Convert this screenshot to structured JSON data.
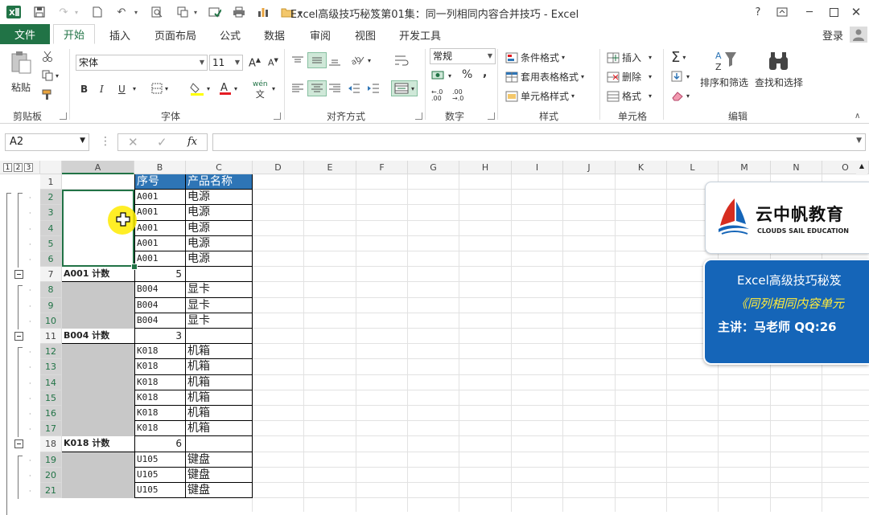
{
  "window": {
    "title": "Excel高级技巧秘笈第01集：同一列相同内容合并技巧 - Excel",
    "help": "?",
    "login": "登录"
  },
  "tabs": {
    "file": "文件",
    "home": "开始",
    "insert": "插入",
    "layout": "页面布局",
    "formula": "公式",
    "data": "数据",
    "review": "审阅",
    "view": "视图",
    "developer": "开发工具"
  },
  "ribbon": {
    "clipboard": {
      "paste": "粘贴",
      "label": "剪贴板"
    },
    "font": {
      "name": "宋体",
      "size": "11",
      "bold": "B",
      "italic": "I",
      "underline": "U",
      "label": "字体",
      "wen": "wén"
    },
    "alignment": {
      "label": "对齐方式"
    },
    "number": {
      "format": "常规",
      "label": "数字"
    },
    "styles": {
      "conditional": "条件格式",
      "table": "套用表格格式",
      "cell": "单元格样式",
      "label": "样式"
    },
    "cells": {
      "insert": "插入",
      "delete": "删除",
      "format": "格式",
      "label": "单元格"
    },
    "editing": {
      "sort": "排序和筛选",
      "find": "查找和选择",
      "label": "编辑"
    }
  },
  "formula_bar": {
    "name_box": "A2",
    "fx": "fx",
    "value": ""
  },
  "sheet": {
    "outline_levels": [
      "1",
      "2",
      "3"
    ],
    "columns": [
      "A",
      "B",
      "C",
      "D",
      "E",
      "F",
      "G",
      "H",
      "I",
      "J",
      "K",
      "L",
      "M",
      "N",
      "O"
    ],
    "rows": [
      {
        "num": "1",
        "a": "",
        "b": "序号",
        "c": "产品名称",
        "kind": "header"
      },
      {
        "num": "2",
        "a": "",
        "b": "A001",
        "c": "电源",
        "kind": "data"
      },
      {
        "num": "3",
        "a": "",
        "b": "A001",
        "c": "电源",
        "kind": "data"
      },
      {
        "num": "4",
        "a": "",
        "b": "A001",
        "c": "电源",
        "kind": "data"
      },
      {
        "num": "5",
        "a": "",
        "b": "A001",
        "c": "电源",
        "kind": "data"
      },
      {
        "num": "6",
        "a": "",
        "b": "A001",
        "c": "电源",
        "kind": "data"
      },
      {
        "num": "7",
        "a": "A001 计数",
        "b": "5",
        "c": "",
        "kind": "sub"
      },
      {
        "num": "8",
        "a": "",
        "b": "B004",
        "c": "显卡",
        "kind": "data"
      },
      {
        "num": "9",
        "a": "",
        "b": "B004",
        "c": "显卡",
        "kind": "data"
      },
      {
        "num": "10",
        "a": "",
        "b": "B004",
        "c": "显卡",
        "kind": "data"
      },
      {
        "num": "11",
        "a": "B004 计数",
        "b": "3",
        "c": "",
        "kind": "sub"
      },
      {
        "num": "12",
        "a": "",
        "b": "K018",
        "c": "机箱",
        "kind": "data"
      },
      {
        "num": "13",
        "a": "",
        "b": "K018",
        "c": "机箱",
        "kind": "data"
      },
      {
        "num": "14",
        "a": "",
        "b": "K018",
        "c": "机箱",
        "kind": "data"
      },
      {
        "num": "15",
        "a": "",
        "b": "K018",
        "c": "机箱",
        "kind": "data"
      },
      {
        "num": "16",
        "a": "",
        "b": "K018",
        "c": "机箱",
        "kind": "data"
      },
      {
        "num": "17",
        "a": "",
        "b": "K018",
        "c": "机箱",
        "kind": "data"
      },
      {
        "num": "18",
        "a": "K018 计数",
        "b": "6",
        "c": "",
        "kind": "sub"
      },
      {
        "num": "19",
        "a": "",
        "b": "U105",
        "c": "键盘",
        "kind": "data"
      },
      {
        "num": "20",
        "a": "",
        "b": "U105",
        "c": "键盘",
        "kind": "data"
      },
      {
        "num": "21",
        "a": "",
        "b": "U105",
        "c": "键盘",
        "kind": "data"
      }
    ]
  },
  "overlay": {
    "brand_cn": "云中帆教育",
    "brand_en": "CLOUDS SAIL EDUCATION",
    "line1": "Excel高级技巧秘笈",
    "line2": "《同列相同内容单元",
    "line3": "主讲：马老师  QQ:26"
  },
  "colors": {
    "excel_green": "#217346",
    "header_blue": "#2e75b6",
    "card_blue": "#1565b8",
    "gray_merge": "#c8c8c8"
  }
}
